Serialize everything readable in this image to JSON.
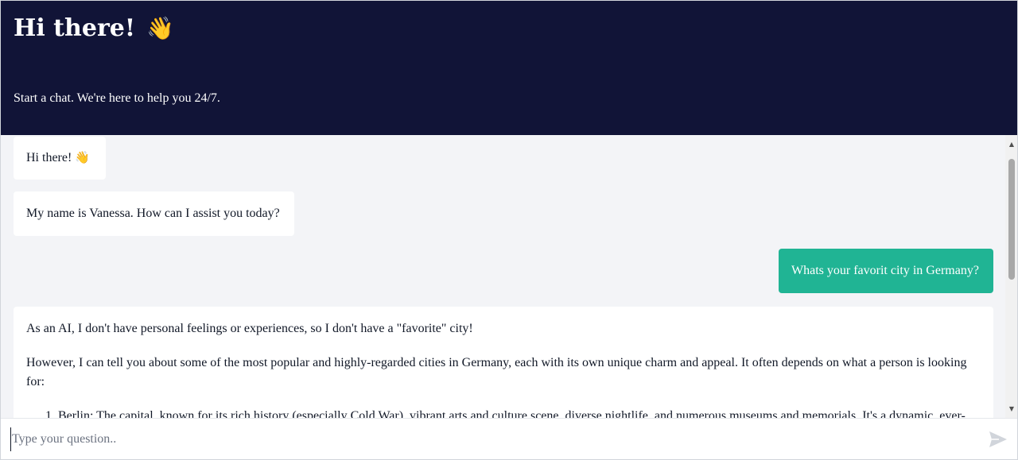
{
  "header": {
    "title": "Hi there!",
    "title_emoji": "👋",
    "subtitle": "Start a chat. We're here to help you 24/7."
  },
  "messages": [
    {
      "role": "bot",
      "text": "Hi there! ",
      "emoji": "👋"
    },
    {
      "role": "bot",
      "text": "My name is Vanessa. How can I assist you today?"
    },
    {
      "role": "user",
      "text": "Whats your favorit city in Germany?"
    },
    {
      "role": "bot",
      "paragraphs": [
        "As an AI, I don't have personal feelings or experiences, so I don't have a \"favorite\" city!",
        "However, I can tell you about some of the most popular and highly-regarded cities in Germany, each with its own unique charm and appeal. It often depends on what a person is looking for:"
      ],
      "list_items": [
        "Berlin: The capital, known for its rich history (especially Cold War), vibrant arts and culture scene, diverse nightlife, and numerous museums and memorials. It's a dynamic, ever-"
      ]
    }
  ],
  "input": {
    "placeholder": "Type your question.."
  },
  "icons": {
    "send": "send-icon",
    "scroll_up": "scroll-up-arrow-icon",
    "scroll_down": "scroll-down-arrow-icon"
  },
  "colors": {
    "header_bg": "#111437",
    "user_bubble": "#20b494",
    "messages_bg": "#f3f4f7"
  }
}
